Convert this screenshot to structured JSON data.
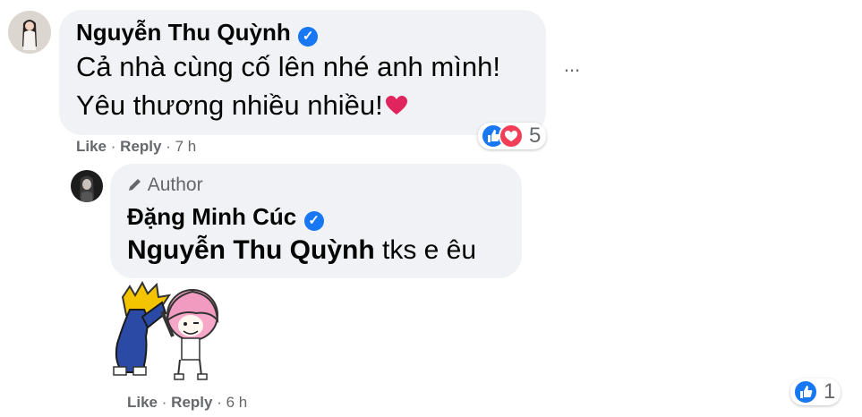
{
  "comment": {
    "author": "Nguyễn Thu Quỳnh",
    "line1": "Cả nhà cùng cố lên nhé anh mình!",
    "line2": "Yêu thương nhiều nhiều!",
    "like_label": "Like",
    "reply_label": "Reply",
    "time": "7 h",
    "reaction_count": "5",
    "more_label": "..."
  },
  "reply": {
    "badge_label": "Author",
    "author": "Đặng Minh Cúc",
    "mention": "Nguyễn Thu Quỳnh",
    "text": " tks e êu",
    "like_label": "Like",
    "reply_label": "Reply",
    "time": "6 h",
    "reaction_count": "1"
  },
  "separator": "·",
  "colors": {
    "bubble": "#f0f2f5",
    "verified": "#1877f2",
    "meta": "#65676b",
    "like": "#1877f2",
    "love": "#f33e58"
  }
}
